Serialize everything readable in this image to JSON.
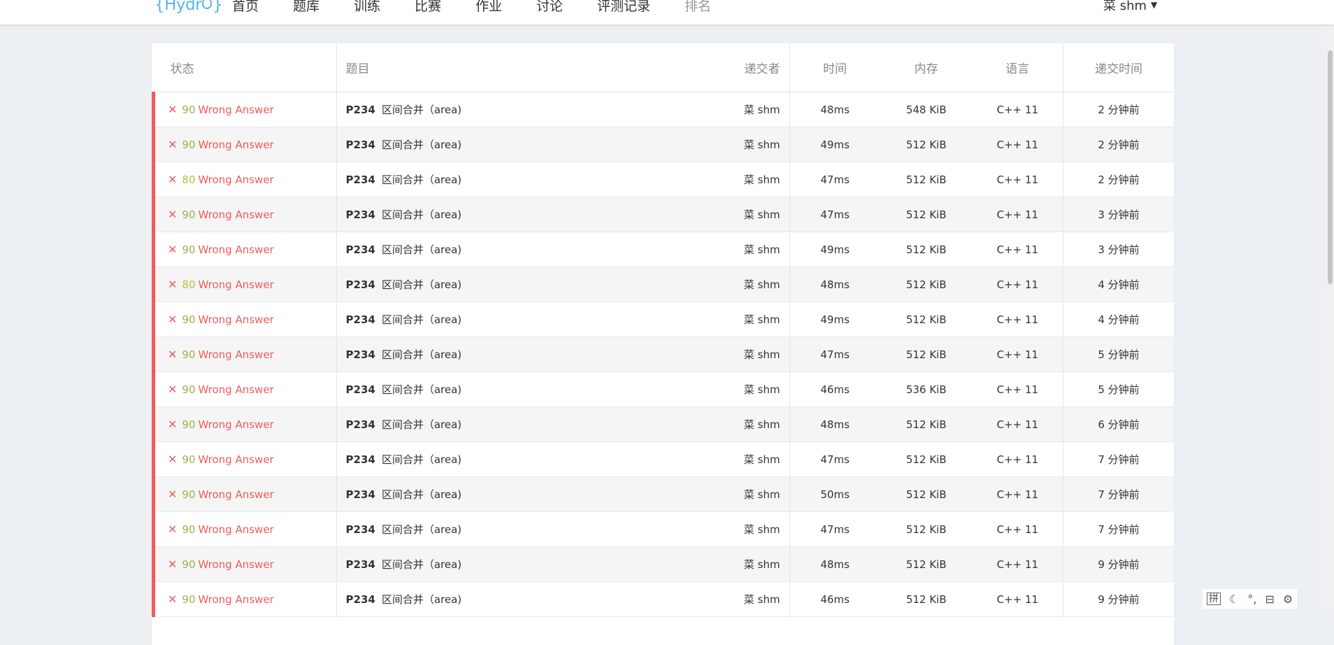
{
  "header": {
    "logo": "Hydr",
    "logo_tail": "",
    "nav": [
      {
        "label": "首页"
      },
      {
        "label": "题库"
      },
      {
        "label": "训练"
      },
      {
        "label": "比赛"
      },
      {
        "label": "作业"
      },
      {
        "label": "讨论"
      },
      {
        "label": "评测记录"
      },
      {
        "label": "排名"
      }
    ],
    "user": "菜 shm"
  },
  "table": {
    "columns": {
      "status": "状态",
      "problem": "题目",
      "submitter": "递交者",
      "time": "时间",
      "memory": "内存",
      "language": "语言",
      "submitted": "递交时间"
    },
    "rows": [
      {
        "score": "90",
        "verdict": "Wrong Answer",
        "pid": "P234",
        "title": "区间合并（area)",
        "user": "菜 shm",
        "time": "48ms",
        "memory": "548 KiB",
        "lang": "C++ 11",
        "when": "2 分钟前"
      },
      {
        "score": "90",
        "verdict": "Wrong Answer",
        "pid": "P234",
        "title": "区间合并（area)",
        "user": "菜 shm",
        "time": "49ms",
        "memory": "512 KiB",
        "lang": "C++ 11",
        "when": "2 分钟前"
      },
      {
        "score": "80",
        "verdict": "Wrong Answer",
        "pid": "P234",
        "title": "区间合并（area)",
        "user": "菜 shm",
        "time": "47ms",
        "memory": "512 KiB",
        "lang": "C++ 11",
        "when": "2 分钟前"
      },
      {
        "score": "90",
        "verdict": "Wrong Answer",
        "pid": "P234",
        "title": "区间合并（area)",
        "user": "菜 shm",
        "time": "47ms",
        "memory": "512 KiB",
        "lang": "C++ 11",
        "when": "3 分钟前"
      },
      {
        "score": "90",
        "verdict": "Wrong Answer",
        "pid": "P234",
        "title": "区间合并（area)",
        "user": "菜 shm",
        "time": "49ms",
        "memory": "512 KiB",
        "lang": "C++ 11",
        "when": "3 分钟前"
      },
      {
        "score": "80",
        "verdict": "Wrong Answer",
        "pid": "P234",
        "title": "区间合并（area)",
        "user": "菜 shm",
        "time": "48ms",
        "memory": "512 KiB",
        "lang": "C++ 11",
        "when": "4 分钟前"
      },
      {
        "score": "90",
        "verdict": "Wrong Answer",
        "pid": "P234",
        "title": "区间合并（area)",
        "user": "菜 shm",
        "time": "49ms",
        "memory": "512 KiB",
        "lang": "C++ 11",
        "when": "4 分钟前"
      },
      {
        "score": "90",
        "verdict": "Wrong Answer",
        "pid": "P234",
        "title": "区间合并（area)",
        "user": "菜 shm",
        "time": "47ms",
        "memory": "512 KiB",
        "lang": "C++ 11",
        "when": "5 分钟前"
      },
      {
        "score": "90",
        "verdict": "Wrong Answer",
        "pid": "P234",
        "title": "区间合并（area)",
        "user": "菜 shm",
        "time": "46ms",
        "memory": "536 KiB",
        "lang": "C++ 11",
        "when": "5 分钟前"
      },
      {
        "score": "90",
        "verdict": "Wrong Answer",
        "pid": "P234",
        "title": "区间合并（area)",
        "user": "菜 shm",
        "time": "48ms",
        "memory": "512 KiB",
        "lang": "C++ 11",
        "when": "6 分钟前"
      },
      {
        "score": "90",
        "verdict": "Wrong Answer",
        "pid": "P234",
        "title": "区间合并（area)",
        "user": "菜 shm",
        "time": "47ms",
        "memory": "512 KiB",
        "lang": "C++ 11",
        "when": "7 分钟前"
      },
      {
        "score": "90",
        "verdict": "Wrong Answer",
        "pid": "P234",
        "title": "区间合并（area)",
        "user": "菜 shm",
        "time": "50ms",
        "memory": "512 KiB",
        "lang": "C++ 11",
        "when": "7 分钟前"
      },
      {
        "score": "90",
        "verdict": "Wrong Answer",
        "pid": "P234",
        "title": "区间合并（area)",
        "user": "菜 shm",
        "time": "47ms",
        "memory": "512 KiB",
        "lang": "C++ 11",
        "when": "7 分钟前"
      },
      {
        "score": "90",
        "verdict": "Wrong Answer",
        "pid": "P234",
        "title": "区间合并（area)",
        "user": "菜 shm",
        "time": "48ms",
        "memory": "512 KiB",
        "lang": "C++ 11",
        "when": "9 分钟前"
      },
      {
        "score": "90",
        "verdict": "Wrong Answer",
        "pid": "P234",
        "title": "区间合并（area)",
        "user": "菜 shm",
        "time": "46ms",
        "memory": "512 KiB",
        "lang": "C++ 11",
        "when": "9 分钟前"
      }
    ]
  },
  "ime": {
    "lang": "拼",
    "icons": [
      "moon-icon",
      "punctuation-icon",
      "simplified-icon",
      "settings-icon"
    ]
  },
  "colors": {
    "accent": "#55b6e6",
    "error": "#f15b5b",
    "score": "#9ab541"
  }
}
